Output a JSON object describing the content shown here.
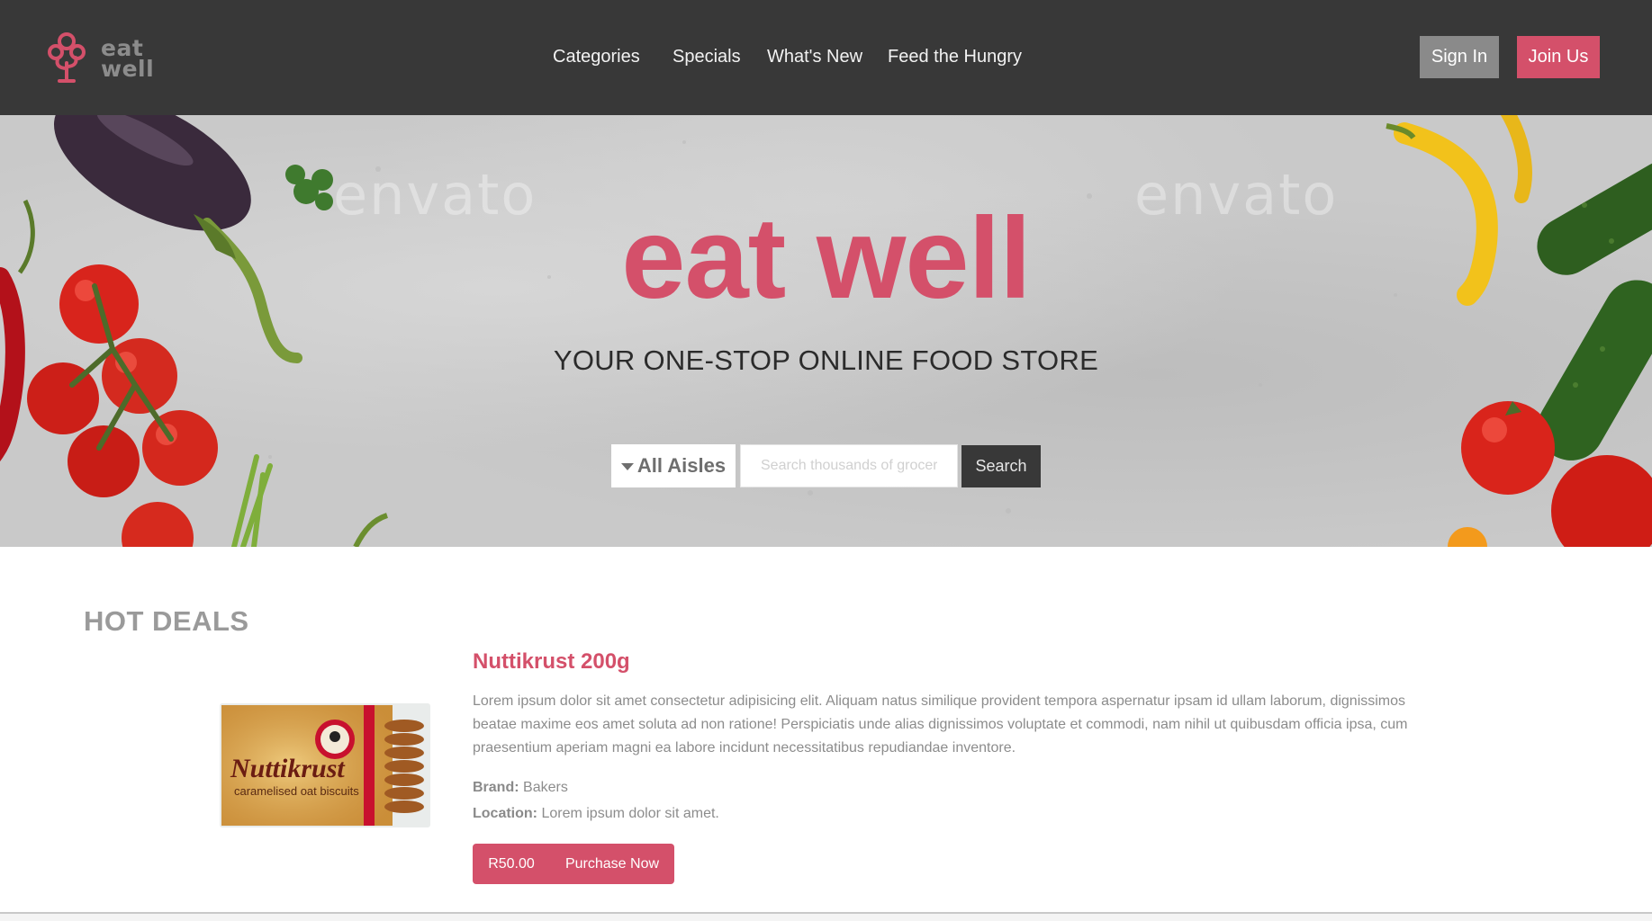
{
  "brand": {
    "logo_line1": "eat",
    "logo_line2": "well"
  },
  "nav": {
    "items": [
      {
        "label": "Categories"
      },
      {
        "label": "Specials"
      },
      {
        "label": "What's New"
      },
      {
        "label": "Feed the Hungry"
      }
    ]
  },
  "auth": {
    "signin_label": "Sign In",
    "join_label": "Join Us"
  },
  "hero": {
    "title": "eat well",
    "subtitle": "YOUR ONE-STOP ONLINE FOOD STORE",
    "aisle_select": "All Aisles",
    "search_placeholder": "Search thousands of groceries",
    "search_button": "Search"
  },
  "deals": {
    "heading": "HOT DEALS",
    "product": {
      "name": "Nuttikrust 200g",
      "description": "Lorem ipsum dolor sit amet consectetur adipisicing elit. Aliquam natus similique provident tempora aspernatur ipsam id ullam laborum, dignissimos beatae maxime eos amet soluta ad non ratione! Perspiciatis unde alias dignissimos voluptate et commodi, nam nihil ut quibusdam officia ipsa, cum praesentium aperiam magni ea labore incidunt necessitatibus repudiandae inventore.",
      "brand_label": "Brand:",
      "brand_value": "Bakers",
      "location_label": "Location:",
      "location_value": "Lorem ipsum dolor sit amet.",
      "price": "R50.00",
      "purchase_label": "Purchase Now",
      "package_brand": "Nuttikrust",
      "package_tagline": "caramelised oat biscuits"
    }
  },
  "colors": {
    "accent": "#d4506a",
    "header_bg": "#383838",
    "muted_text": "#8c8c8c"
  },
  "watermark_text": "envato"
}
